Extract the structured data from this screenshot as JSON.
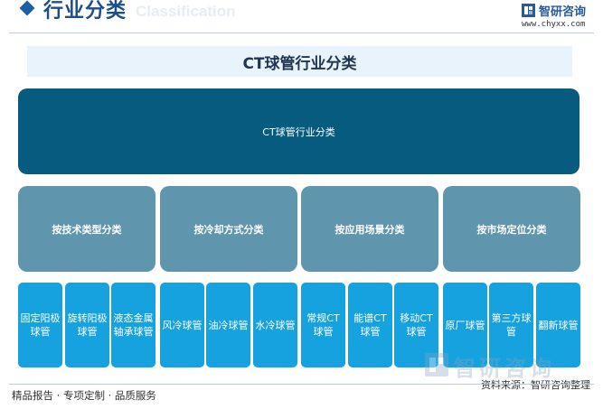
{
  "header": {
    "title": "行业分类",
    "title_en": "Classification",
    "logo_name": "智研咨询",
    "logo_url": "www.chyxx.com"
  },
  "diagram": {
    "title": "CT球管行业分类",
    "root": "CT球管行业分类",
    "categories": [
      {
        "label": "按技术类型分类",
        "items": [
          "固定阳极球管",
          "旋转阳极球管",
          "液态金属轴承球管"
        ]
      },
      {
        "label": "按冷却方式分类",
        "items": [
          "风冷球管",
          "油冷球管",
          "水冷球管"
        ]
      },
      {
        "label": "按应用场景分类",
        "items": [
          "常规CT球管",
          "能谱CT球管",
          "移动CT球管"
        ]
      },
      {
        "label": "按市场定位分类",
        "items": [
          "原厂球管",
          "第三方球管",
          "翻新球管"
        ]
      }
    ]
  },
  "footer": {
    "left": "精品报告 · 专项定制 · 品质服务",
    "right": "资料来源：智研咨询整理",
    "watermark": "智研咨询"
  },
  "colors": {
    "root": "#075b7f",
    "category": "#5f95ad",
    "leaf": "#16a2de",
    "title_bg": "#e8f3fc"
  }
}
